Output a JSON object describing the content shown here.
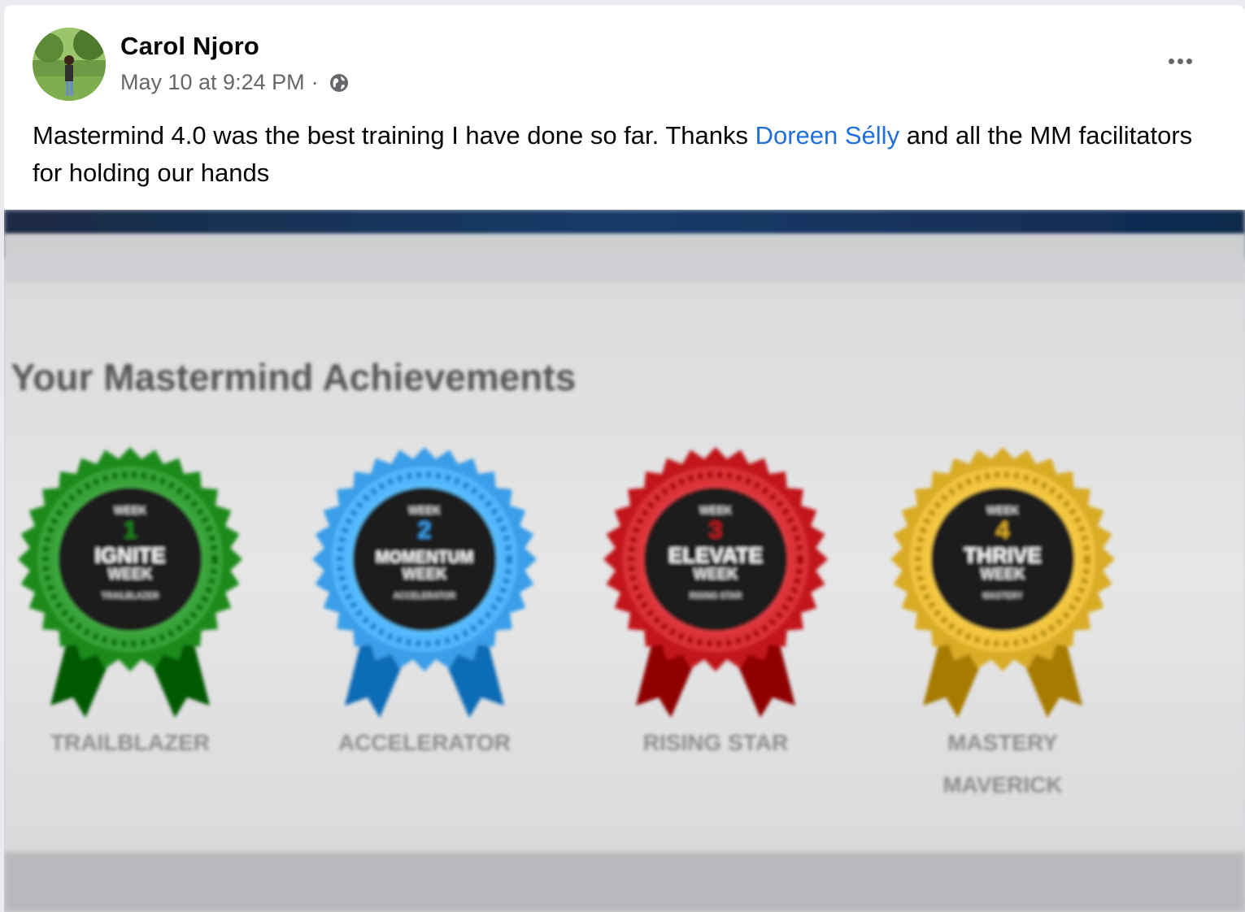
{
  "post": {
    "author": "Carol Njoro",
    "timestamp": "May 10 at 9:24 PM",
    "separator": "·",
    "privacy_icon": "globe-icon",
    "more_icon": "more-options-icon",
    "text_before": "Mastermind 4.0 was the best training I have done so far. Thanks ",
    "mention": "Doreen Sélly",
    "text_after": " and all the MM facilitators for holding our hands"
  },
  "photo": {
    "heading": "Your Mastermind Achievements",
    "badges": [
      {
        "color": "#1f8a1f",
        "week_label": "WEEK",
        "number": "1",
        "title": "IGNITE",
        "subtitle": "WEEK",
        "caption": "TRAILBLAZER"
      },
      {
        "color": "#3a9ee8",
        "week_label": "WEEK",
        "number": "2",
        "title": "MOMENTUM",
        "subtitle": "WEEK",
        "caption": "ACCELERATOR"
      },
      {
        "color": "#c2191e",
        "week_label": "WEEK",
        "number": "3",
        "title": "ELEVATE",
        "subtitle": "WEEK",
        "caption": "RISING STAR"
      },
      {
        "color": "#d9ac25",
        "week_label": "WEEK",
        "number": "4",
        "title": "THRIVE",
        "subtitle": "WEEK",
        "caption": "MASTERY",
        "caption2": "MAVERICK"
      }
    ]
  }
}
